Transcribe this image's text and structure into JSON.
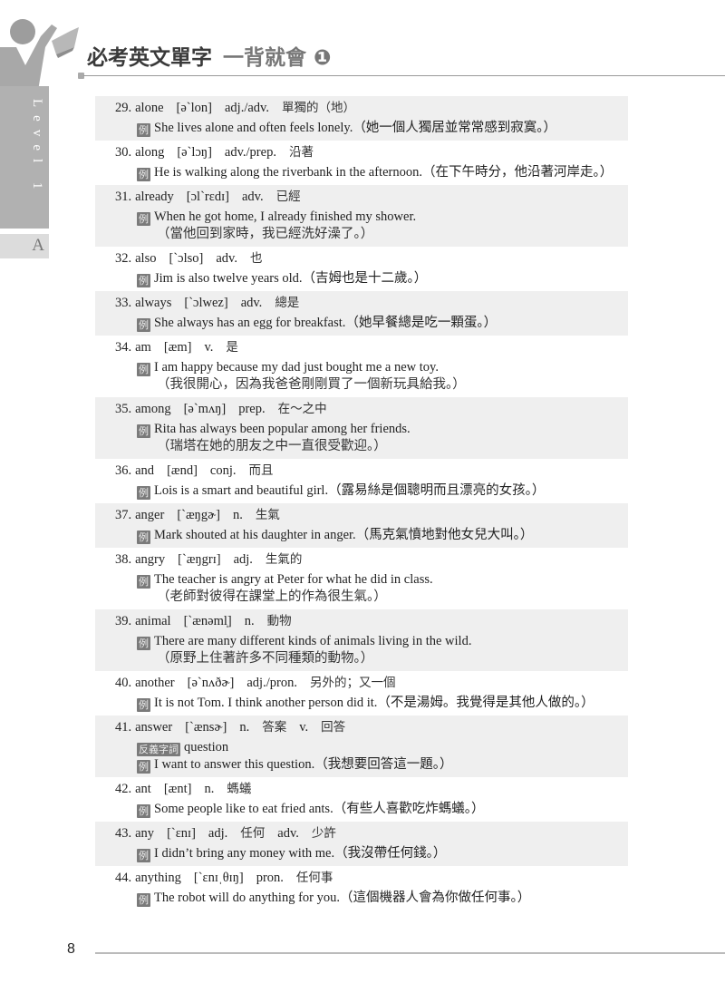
{
  "header": {
    "title_bold": "必考英文單字",
    "title_light": "一背就會 ❶"
  },
  "sidebar": {
    "level_label": "Level 1",
    "tab_letter": "A"
  },
  "example_icon": "例",
  "antonym_icon": "反義字詞",
  "entries": [
    {
      "num": "29.",
      "word": "alone",
      "ipa": "[ə`lon]",
      "pos": "adj./adv.",
      "meaning": "單獨的（地）",
      "lines": [
        {
          "kind": "ex",
          "text": "She lives alone and often feels lonely.（她一個人獨居並常常感到寂寞。）"
        }
      ]
    },
    {
      "num": "30.",
      "word": "along",
      "ipa": "[ə`lɔŋ]",
      "pos": "adv./prep.",
      "meaning": "沿著",
      "lines": [
        {
          "kind": "ex",
          "text": "He is walking along the riverbank in the afternoon.（在下午時分，他沿著河岸走。）"
        }
      ]
    },
    {
      "num": "31.",
      "word": "already",
      "ipa": "[ɔl`rɛdɪ]",
      "pos": "adv.",
      "meaning": "已經",
      "lines": [
        {
          "kind": "ex",
          "text": "When he got home, I already finished my shower."
        },
        {
          "kind": "tr",
          "text": "（當他回到家時，我已經洗好澡了。）"
        }
      ]
    },
    {
      "num": "32.",
      "word": "also",
      "ipa": "[`ɔlso]",
      "pos": "adv.",
      "meaning": "也",
      "lines": [
        {
          "kind": "ex",
          "text": "Jim is also twelve years old.（吉姆也是十二歲。）"
        }
      ]
    },
    {
      "num": "33.",
      "word": "always",
      "ipa": "[`ɔlwez]",
      "pos": "adv.",
      "meaning": "總是",
      "lines": [
        {
          "kind": "ex",
          "text": "She always has an egg for breakfast.（她早餐總是吃一顆蛋。）"
        }
      ]
    },
    {
      "num": "34.",
      "word": "am",
      "ipa": "[æm]",
      "pos": "v.",
      "meaning": "是",
      "lines": [
        {
          "kind": "ex",
          "text": "I am happy because my dad just bought me a new toy."
        },
        {
          "kind": "tr",
          "text": "（我很開心，因為我爸爸剛剛買了一個新玩具給我。）"
        }
      ]
    },
    {
      "num": "35.",
      "word": "among",
      "ipa": "[ə`mʌŋ]",
      "pos": "prep.",
      "meaning": "在～之中",
      "lines": [
        {
          "kind": "ex",
          "text": "Rita has always been popular among her friends."
        },
        {
          "kind": "tr",
          "text": "（瑞塔在她的朋友之中一直很受歡迎。）"
        }
      ]
    },
    {
      "num": "36.",
      "word": "and",
      "ipa": "[ænd]",
      "pos": "conj.",
      "meaning": "而且",
      "lines": [
        {
          "kind": "ex",
          "text": "Lois is a smart and beautiful girl.（露易絲是個聰明而且漂亮的女孩。）"
        }
      ]
    },
    {
      "num": "37.",
      "word": "anger",
      "ipa": "[`æŋgɚ]",
      "pos": "n.",
      "meaning": "生氣",
      "lines": [
        {
          "kind": "ex",
          "text": "Mark shouted at his daughter in anger.（馬克氣憤地對他女兒大叫。）"
        }
      ]
    },
    {
      "num": "38.",
      "word": "angry",
      "ipa": "[`æŋgrɪ]",
      "pos": "adj.",
      "meaning": "生氣的",
      "lines": [
        {
          "kind": "ex",
          "text": "The teacher is angry at Peter for what he did in class."
        },
        {
          "kind": "tr",
          "text": "（老師對彼得在課堂上的作為很生氣。）"
        }
      ]
    },
    {
      "num": "39.",
      "word": "animal",
      "ipa": "[`ænəml̩]",
      "pos": "n.",
      "meaning": "動物",
      "lines": [
        {
          "kind": "ex",
          "text": "There are many different kinds of animals living in the wild."
        },
        {
          "kind": "tr",
          "text": "（原野上住著許多不同種類的動物。）"
        }
      ]
    },
    {
      "num": "40.",
      "word": "another",
      "ipa": "[ə`nʌðɚ]",
      "pos": "adj./pron.",
      "meaning": "另外的；又一個",
      "lines": [
        {
          "kind": "ex",
          "text": "It is not Tom. I think another person did it.（不是湯姆。我覺得是其他人做的。）"
        }
      ]
    },
    {
      "num": "41.",
      "word": "answer",
      "ipa": "[`ænsɚ]",
      "pos": "n.",
      "meaning": "答案",
      "pos2": "v.",
      "meaning2": "回答",
      "lines": [
        {
          "kind": "ant",
          "text": "question"
        },
        {
          "kind": "ex",
          "text": "I want to answer this question.（我想要回答這一題。）"
        }
      ]
    },
    {
      "num": "42.",
      "word": "ant",
      "ipa": "[ænt]",
      "pos": "n.",
      "meaning": "螞蟻",
      "lines": [
        {
          "kind": "ex",
          "text": "Some people like to eat fried ants.（有些人喜歡吃炸螞蟻。）"
        }
      ]
    },
    {
      "num": "43.",
      "word": "any",
      "ipa": "[`ɛnɪ]",
      "pos": "adj.",
      "meaning": "任何",
      "pos2": "adv.",
      "meaning2": "少許",
      "lines": [
        {
          "kind": "ex",
          "text": "I didn’t bring any money with me.（我沒帶任何錢。）"
        }
      ]
    },
    {
      "num": "44.",
      "word": "anything",
      "ipa": "[`ɛnɪˌθɪŋ]",
      "pos": "pron.",
      "meaning": "任何事",
      "lines": [
        {
          "kind": "ex",
          "text": "The robot will do anything for you.（這個機器人會為你做任何事。）"
        }
      ]
    }
  ],
  "footer": {
    "page_number": "8"
  }
}
